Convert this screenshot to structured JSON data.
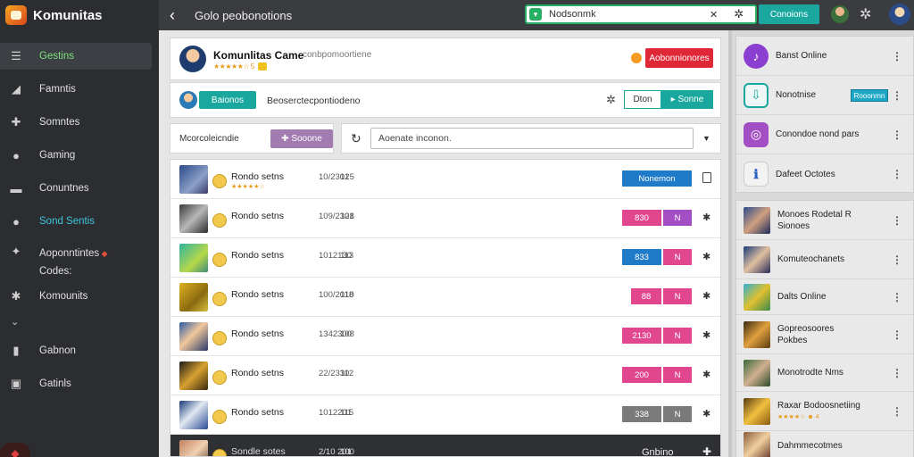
{
  "app": {
    "title": "Komunitas"
  },
  "sidebar": {
    "items": [
      {
        "label": "Gestins",
        "icon": "menu-icon"
      },
      {
        "label": "Famntis",
        "icon": "chart-icon"
      },
      {
        "label": "Somntes",
        "icon": "puzzle-icon"
      },
      {
        "label": "Gaming",
        "icon": "info-icon"
      },
      {
        "label": "Conuntnes",
        "icon": "monitor-icon"
      },
      {
        "label": "Sond Sentis",
        "icon": "user-icon"
      },
      {
        "label": "Aoponntintes",
        "label2": "Codes:",
        "icon": "gamepad-icon"
      },
      {
        "label": "Komounits",
        "icon": "network-icon"
      },
      {
        "label": "Gabnon",
        "icon": "book-icon"
      },
      {
        "label": "Gatinls",
        "icon": "box-icon"
      }
    ]
  },
  "topbar": {
    "title": "Golo peobonotions",
    "search_value": "Nodsonmk",
    "search_button": "Conoions"
  },
  "header": {
    "name": "Komunlitas Came",
    "subtitle": "conbpomoortiene",
    "stars": "★★★★★☆ 5",
    "join": "Aobonnionores"
  },
  "subbar": {
    "tag": "Baionos",
    "description": "Beoserctecpontiodeno",
    "outline_btn": "Dton",
    "fill_btn": "▸ Sonne"
  },
  "filter": {
    "label": "Mcorcoleicndie",
    "chip": "✚ Sooone",
    "select_value": "Aoenate inconon."
  },
  "rows": [
    {
      "name": "Rondo setns",
      "stars": "★★★★★☆",
      "time": "10/2301",
      "count": "125",
      "button": "Nonemon"
    },
    {
      "name": "Rondo setns",
      "time": "109/2301",
      "count": "128",
      "pill": "830",
      "tag": "N"
    },
    {
      "name": "Rondo setns",
      "time": "1012130",
      "count": "113",
      "pill": "833",
      "tag": "N"
    },
    {
      "name": "Rondo setns",
      "time": "100/2010",
      "count": "118",
      "pill": "88",
      "tag": "N"
    },
    {
      "name": "Rondo setns",
      "time": "1342300",
      "count": "108",
      "pill": "2130",
      "tag": "N"
    },
    {
      "name": "Rondo setns",
      "time": "22/2330",
      "count": "112",
      "pill": "200",
      "tag": "N"
    },
    {
      "name": "Rondo setns",
      "time": "1012201",
      "count": "115",
      "pill": "338",
      "tag": "N"
    },
    {
      "name": "Sondle sotes",
      "time": "2/10 201",
      "count": "100",
      "dark_label": "Gnbino"
    }
  ],
  "right": {
    "top_items": [
      {
        "label": "Banst Online"
      },
      {
        "label": "Nonotnise",
        "mini": "Rooonmn"
      },
      {
        "label": "Conondoe nond pars"
      },
      {
        "label": "Dafeet Octotes"
      }
    ],
    "bottom_items": [
      {
        "label": "Monoes Rodetal R",
        "label2": "Sionoes"
      },
      {
        "label": "Komuteochanets"
      },
      {
        "label": "Dalts Online"
      },
      {
        "label": "Gopreosoores",
        "label2": "Pokbes"
      },
      {
        "label": "Monotrodte Nms"
      },
      {
        "label": "Raxar Bodoosnetiing",
        "stars": "★★★★☆ ☻ 4"
      },
      {
        "label": "Dahmmecotmes"
      }
    ]
  },
  "colors": {
    "sidebar_bg": "#2b2d30",
    "topbar_bg": "#3a3c40",
    "teal": "#1aa89e",
    "red": "#e02738",
    "blue": "#1f7bc7",
    "pink": "#e0478f",
    "purple": "#a34fc3",
    "gray_pill": "#7a7a7a"
  }
}
